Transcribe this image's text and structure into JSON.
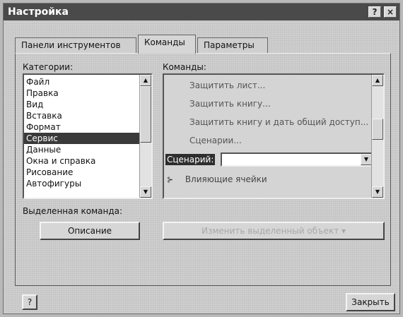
{
  "window": {
    "title": "Настройка",
    "help_glyph": "?",
    "close_glyph": "×"
  },
  "tabs": [
    {
      "label": "Панели инструментов"
    },
    {
      "label": "Команды"
    },
    {
      "label": "Параметры"
    }
  ],
  "categories": {
    "label": "Категории:",
    "items": [
      "Файл",
      "Правка",
      "Вид",
      "Вставка",
      "Формат",
      "Сервис",
      "Данные",
      "Окна и справка",
      "Рисование",
      "Автофигуры"
    ],
    "selected": "Сервис"
  },
  "commands": {
    "label": "Команды:",
    "items": [
      "Защитить лист...",
      "Защитить книгу...",
      "Защитить книгу и дать общий доступ...",
      "Сценарии..."
    ],
    "combo_label": "Сценарий:",
    "combo_value": "",
    "last_item": "Влияющие ячейки"
  },
  "selected_command": {
    "label": "Выделенная команда:",
    "description_button": "Описание",
    "modify_button": "Изменить выделенный объект ▾"
  },
  "footer": {
    "help_button": "?",
    "close_button": "Закрыть"
  },
  "icons": {
    "scroll_up": "▲",
    "scroll_down": "▼",
    "combo_arrow": "▼"
  }
}
